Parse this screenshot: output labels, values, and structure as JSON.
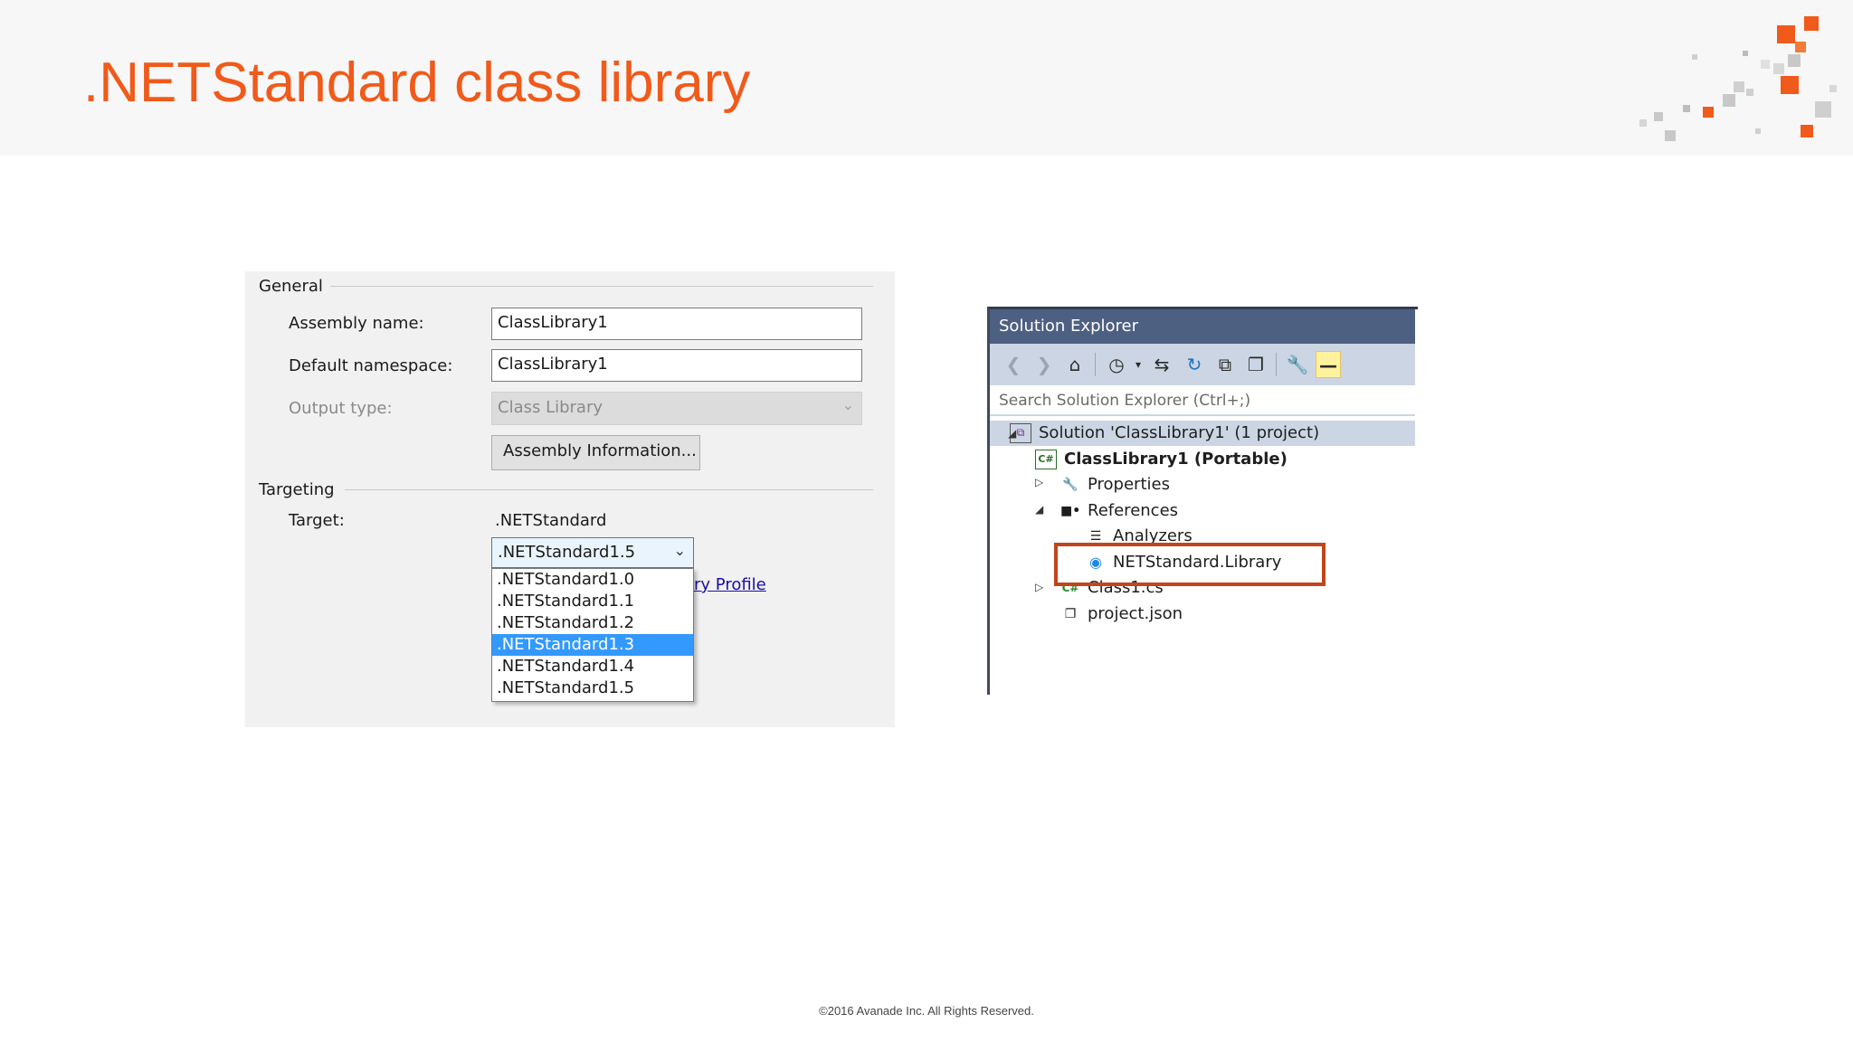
{
  "slide": {
    "title": ".NETStandard class library",
    "footer": "©2016 Avanade Inc. All Rights Reserved.",
    "accent_color": "#f05a1a"
  },
  "properties_panel": {
    "general_header": "General",
    "assembly_name_label": "Assembly name:",
    "assembly_name_value": "ClassLibrary1",
    "default_namespace_label": "Default namespace:",
    "default_namespace_value": "ClassLibrary1",
    "output_type_label": "Output type:",
    "output_type_value": "Class Library",
    "assembly_info_button": "Assembly Information...",
    "targeting_header": "Targeting",
    "target_label": "Target:",
    "target_value": ".NETStandard",
    "target_version_selected": ".NETStandard1.5",
    "target_version_options": [
      ".NETStandard1.0",
      ".NETStandard1.1",
      ".NETStandard1.2",
      ".NETStandard1.3",
      ".NETStandard1.4",
      ".NETStandard1.5"
    ],
    "highlighted_option": ".NETStandard1.3",
    "partial_link_text": "ry Profile"
  },
  "solution_explorer": {
    "title": "Solution Explorer",
    "search_placeholder": "Search Solution Explorer (Ctrl+;)",
    "toolbar_icons": [
      "back-icon",
      "forward-icon",
      "home-icon",
      "history-icon",
      "sync-icon",
      "refresh-icon",
      "collapse-all-icon",
      "show-all-files-icon",
      "properties-wrench-icon",
      "preview-icon"
    ],
    "tree": {
      "solution": "Solution 'ClassLibrary1' (1 project)",
      "project": "ClassLibrary1 (Portable)",
      "properties": "Properties",
      "references": "References",
      "analyzers": "Analyzers",
      "netstandard_library": "NETStandard.Library",
      "class1": "Class1.cs",
      "project_json": "project.json"
    },
    "highlight_color": "#c0461b"
  }
}
